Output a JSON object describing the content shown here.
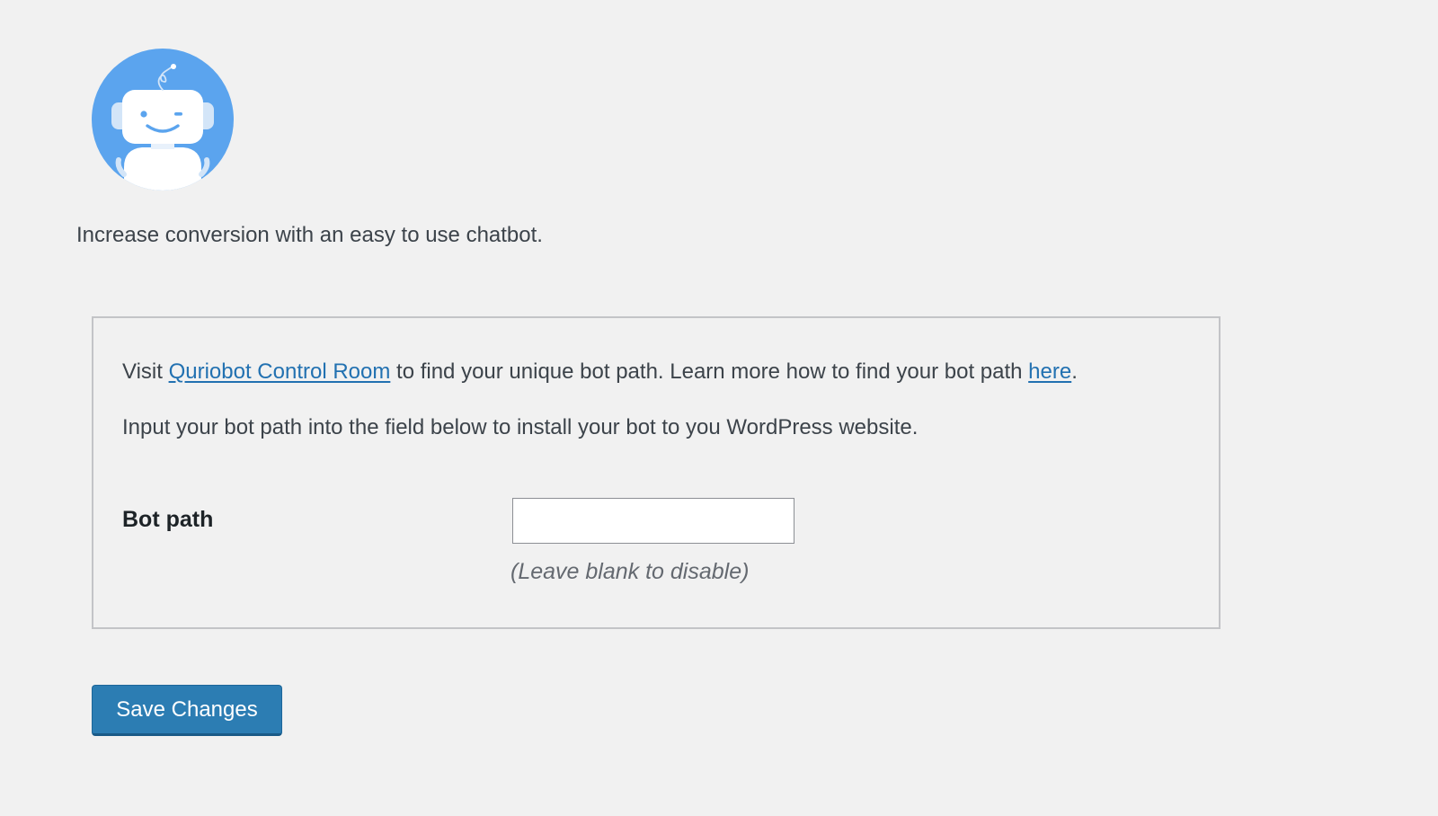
{
  "logo": {
    "icon": "chatbot-robot-icon",
    "colors": {
      "circle": "#5ba4ee",
      "robot": "#ffffff",
      "ears": "#d3e5f8",
      "features": "#5ba4ee"
    }
  },
  "tagline": "Increase conversion with an easy to use chatbot.",
  "panel": {
    "intro": {
      "visit": "Visit ",
      "control_room_link": "Quriobot Control Room",
      "middle": " to find your unique bot path. Learn more how to find your bot path ",
      "here_link": "here",
      "period": "."
    },
    "instruction": "Input your bot path into the field below to install your bot to you WordPress website.",
    "bot_path": {
      "label": "Bot path",
      "value": "",
      "hint": "(Leave blank to disable)"
    }
  },
  "save_button": "Save Changes",
  "colors": {
    "background": "#f1f1f1",
    "link": "#2271b1",
    "button": "#2c7db3",
    "border": "#c3c4c7"
  }
}
